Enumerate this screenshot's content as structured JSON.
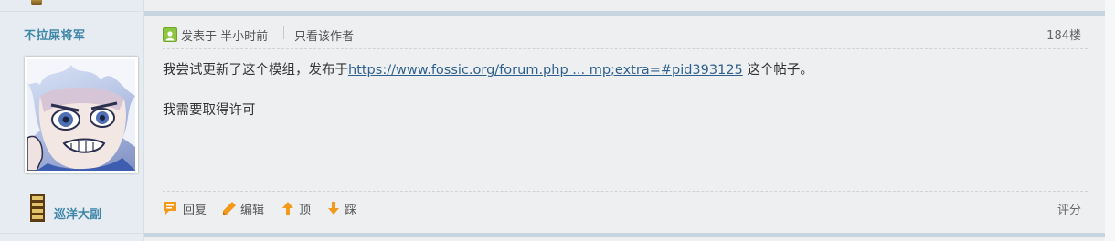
{
  "author": {
    "name": "不拉屎将军",
    "rank_title": "巡洋大副"
  },
  "post": {
    "posted_time": "发表于 半小时前",
    "only_author_label": "只看该作者",
    "floor": "184楼",
    "line1_text": "我尝试更新了这个模组，发布于",
    "link_text": "https://www.fossic.org/forum.php ... mp;extra=#pid393125",
    "line1_suffix": " 这个帖子。",
    "line2_text": "我需要取得许可"
  },
  "actions": {
    "reply": "回复",
    "edit": "编辑",
    "up": "顶",
    "down": "踩",
    "rate": "评分"
  },
  "colors": {
    "accent": "#3f86a9",
    "link": "#2f5f8c",
    "action_icon": "#f39a1d",
    "online": "#8dc63f"
  }
}
